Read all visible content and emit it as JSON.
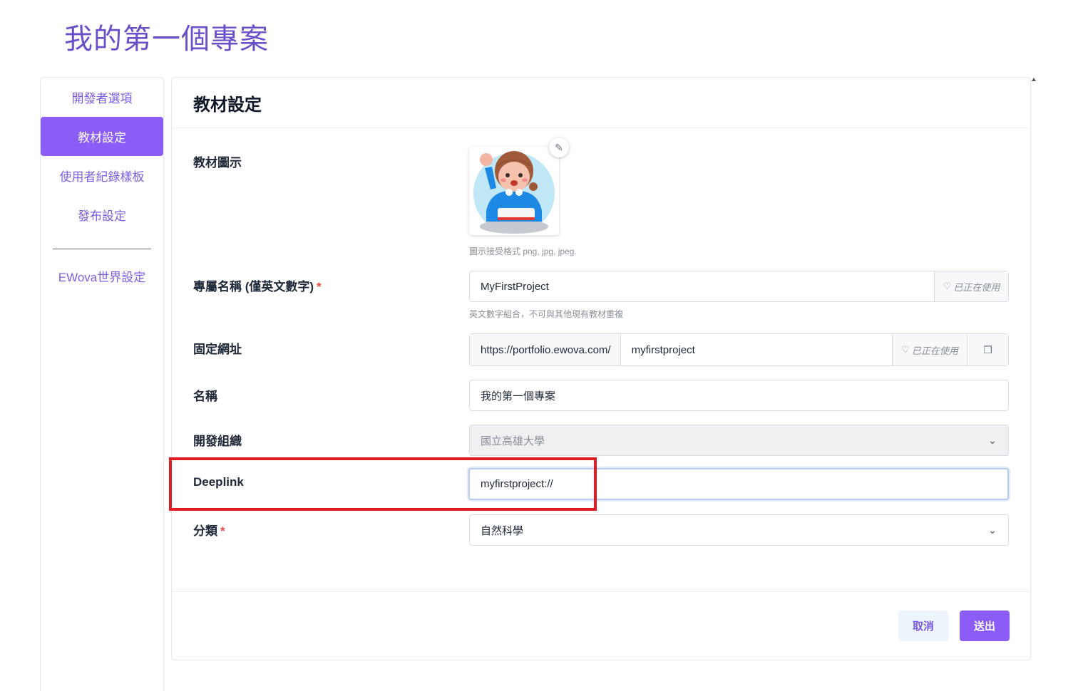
{
  "page": {
    "title": "我的第一個專案"
  },
  "sidebar": {
    "items": [
      {
        "label": "開發者選項",
        "active": false
      },
      {
        "label": "教材設定",
        "active": true
      },
      {
        "label": "使用者紀錄樣板",
        "active": false
      },
      {
        "label": "發布設定",
        "active": false
      }
    ],
    "extra_item": {
      "label": "EWova世界設定"
    }
  },
  "card": {
    "title": "教材設定"
  },
  "form": {
    "icon": {
      "label": "教材圖示",
      "help": "圖示接受格式 png, jpg, jpeg.",
      "edit_icon": "pencil-icon"
    },
    "slug": {
      "label": "專屬名稱 (僅英文數字)",
      "required_mark": "*",
      "value": "MyFirstProject",
      "status": "已正在使用",
      "status_icon": "shield-icon",
      "help": "英文數字組合，不可與其他現有教材重複"
    },
    "url": {
      "label": "固定網址",
      "prefix": "https://portfolio.ewova.com/",
      "value": "myfirstproject",
      "status": "已正在使用",
      "status_icon": "shield-icon",
      "copy_icon": "copy-icon"
    },
    "name": {
      "label": "名稱",
      "value": "我的第一個專案"
    },
    "org": {
      "label": "開發組織",
      "value": "國立高雄大學",
      "disabled": true
    },
    "deeplink": {
      "label": "Deeplink",
      "value": "myfirstproject://"
    },
    "category": {
      "label": "分類",
      "required_mark": "*",
      "value": "自然科學"
    }
  },
  "footer": {
    "cancel_label": "取消",
    "submit_label": "送出"
  },
  "colors": {
    "accent": "#8b5cf6",
    "title": "#6b4fc9",
    "highlight": "#e01b24",
    "required": "#ef4444"
  }
}
